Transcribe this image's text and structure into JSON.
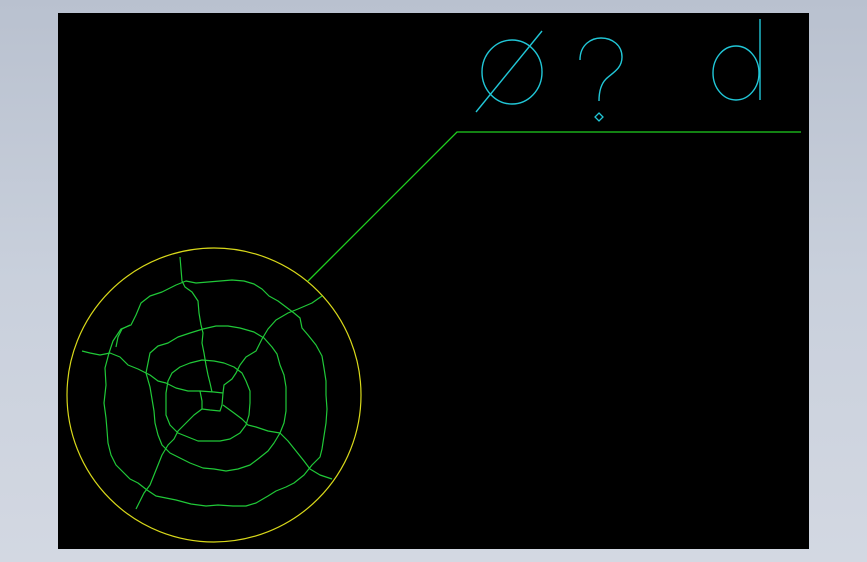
{
  "annotation": {
    "symbols": [
      "Ø",
      "?",
      "d"
    ]
  },
  "colors": {
    "background": "#000000",
    "frame": "#c3c9d6",
    "symbol_text": "#21c6d6",
    "leader_line": "#1fd01f",
    "cracks": "#20c838",
    "boundary_circle": "#d8d81a"
  },
  "icons": {
    "diameter": "diameter-symbol-icon"
  }
}
